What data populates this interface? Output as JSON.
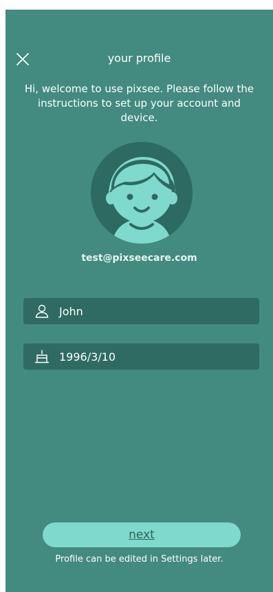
{
  "header": {
    "title": "your profile",
    "close_icon": "close-icon"
  },
  "welcome_text": "Hi, welcome to use pixsee. Please follow the instructions to set up your account and device.",
  "profile": {
    "avatar_icon": "child-avatar-icon",
    "email": "test@pixseecare.com"
  },
  "fields": {
    "name": {
      "icon": "person-icon",
      "value": "John"
    },
    "birthday": {
      "icon": "cake-icon",
      "value": "1996/3/10"
    }
  },
  "footer": {
    "next_label": "next",
    "note": "Profile can be edited in Settings later."
  },
  "colors": {
    "background": "#438a80",
    "field_background": "#2f6b62",
    "button_background": "#7fd9cc",
    "avatar_dark": "#2d6a61",
    "avatar_light": "#7fd9cc"
  }
}
